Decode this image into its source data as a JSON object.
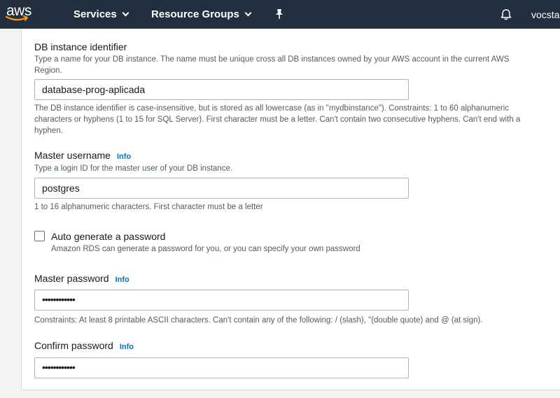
{
  "nav": {
    "logo_text": "aws",
    "services": "Services",
    "resource_groups": "Resource Groups",
    "user": "vocstar"
  },
  "form": {
    "db_identifier": {
      "label": "DB instance identifier",
      "description": "Type a name for your DB instance. The name must be unique cross all DB instances owned by your AWS account in the current AWS Region.",
      "value": "database-prog-aplicada",
      "constraint": "The DB instance identifier is case-insensitive, but is stored as all lowercase (as in \"mydbinstance\"). Constraints: 1 to 60 alphanumeric characters or hyphens (1 to 15 for SQL Server). First character must be a letter. Can't contain two consecutive hyphens. Can't end with a hyphen."
    },
    "master_username": {
      "label": "Master username",
      "info": "Info",
      "description": "Type a login ID for the master user of your DB instance.",
      "value": "postgres",
      "constraint": "1 to 16 alphanumeric characters. First character must be a letter"
    },
    "auto_password": {
      "label": "Auto generate a password",
      "description": "Amazon RDS can generate a password for you, or you can specify your own password",
      "checked": false
    },
    "master_password": {
      "label": "Master password",
      "info": "Info",
      "value": "••••••••••••",
      "constraint": "Constraints: At least 8 printable ASCII characters. Can't contain any of the following: / (slash), \"(double quote) and @ (at sign)."
    },
    "confirm_password": {
      "label": "Confirm password",
      "info": "Info",
      "value": "••••••••••••"
    }
  },
  "colors": {
    "nav_bg": "#232f3e",
    "link": "#0073bb",
    "aws_orange": "#ff9900"
  }
}
